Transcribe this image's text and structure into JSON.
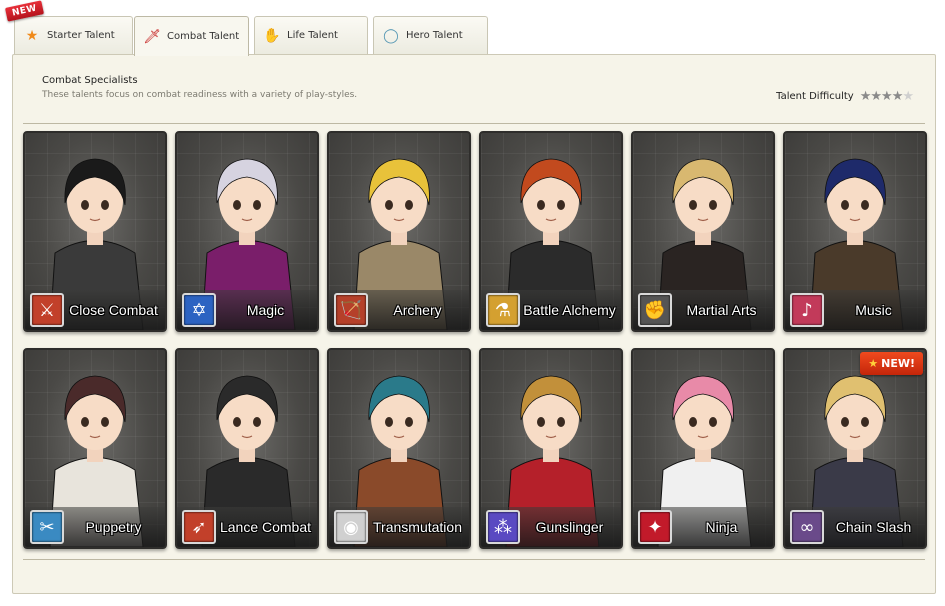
{
  "new_badge": "NEW",
  "tabs": [
    {
      "label": "Starter Talent",
      "icon": "star-icon",
      "glyph": "★",
      "color": "#f08a1a"
    },
    {
      "label": "Combat Talent",
      "icon": "sword-icon",
      "glyph": "🗡",
      "color": "#c31a1a"
    },
    {
      "label": "Life Talent",
      "icon": "hands-icon",
      "glyph": "✋",
      "color": "#e0902a"
    },
    {
      "label": "Hero Talent",
      "icon": "ring-icon",
      "glyph": "◯",
      "color": "#5a9ab5"
    }
  ],
  "section": {
    "heading": "Combat Specialists",
    "description": "These talents focus on combat readiness with a variety of play-styles.",
    "difficulty_label": "Talent Difficulty",
    "difficulty_rating": 4,
    "difficulty_max": 5
  },
  "talents": [
    {
      "name": "Close Combat",
      "icon": "sword-icon",
      "glyph": "⚔",
      "icon_bg": "#c2402a",
      "hair": "#1a1a1a",
      "outfit": "#3a3a3a"
    },
    {
      "name": "Magic",
      "icon": "star-of-david-icon",
      "glyph": "✡",
      "icon_bg": "#2c63c2",
      "hair": "#d6d3e0",
      "outfit": "#7a1e6a"
    },
    {
      "name": "Archery",
      "icon": "bow-icon",
      "glyph": "🏹",
      "icon_bg": "#b5402a",
      "hair": "#e8c23a",
      "outfit": "#9a8868"
    },
    {
      "name": "Battle Alchemy",
      "icon": "cylinder-icon",
      "glyph": "⚗",
      "icon_bg": "#d4a030",
      "hair": "#c24a1e",
      "outfit": "#2b2b2b"
    },
    {
      "name": "Martial Arts",
      "icon": "fist-icon",
      "glyph": "✊",
      "icon_bg": "#555555",
      "hair": "#d8b870",
      "outfit": "#2a2422"
    },
    {
      "name": "Music",
      "icon": "lute-icon",
      "glyph": "♪",
      "icon_bg": "#c23a5a",
      "hair": "#1e2a6a",
      "outfit": "#4a3a2a"
    },
    {
      "name": "Puppetry",
      "icon": "puppet-icon",
      "glyph": "✂",
      "icon_bg": "#3a8ac2",
      "hair": "#4a2a2a",
      "outfit": "#e8e4dc"
    },
    {
      "name": "Lance Combat",
      "icon": "lance-icon",
      "glyph": "➶",
      "icon_bg": "#c2402a",
      "hair": "#2a2a2a",
      "outfit": "#2a2a2a"
    },
    {
      "name": "Transmutation",
      "icon": "orb-icon",
      "glyph": "◉",
      "icon_bg": "#d0d0d0",
      "hair": "#2a7a8a",
      "outfit": "#8a4a2a"
    },
    {
      "name": "Gunslinger",
      "icon": "guns-icon",
      "glyph": "⁂",
      "icon_bg": "#5a4ac2",
      "hair": "#c2903a",
      "outfit": "#b5202a"
    },
    {
      "name": "Ninja",
      "icon": "shuriken-icon",
      "glyph": "✦",
      "icon_bg": "#c21a2a",
      "hair": "#e88aa8",
      "outfit": "#f0f0f0"
    },
    {
      "name": "Chain Slash",
      "icon": "chain-icon",
      "glyph": "∞",
      "icon_bg": "#6a4a8a",
      "hair": "#e0c070",
      "outfit": "#3a3a48",
      "new": "NEW!"
    }
  ]
}
